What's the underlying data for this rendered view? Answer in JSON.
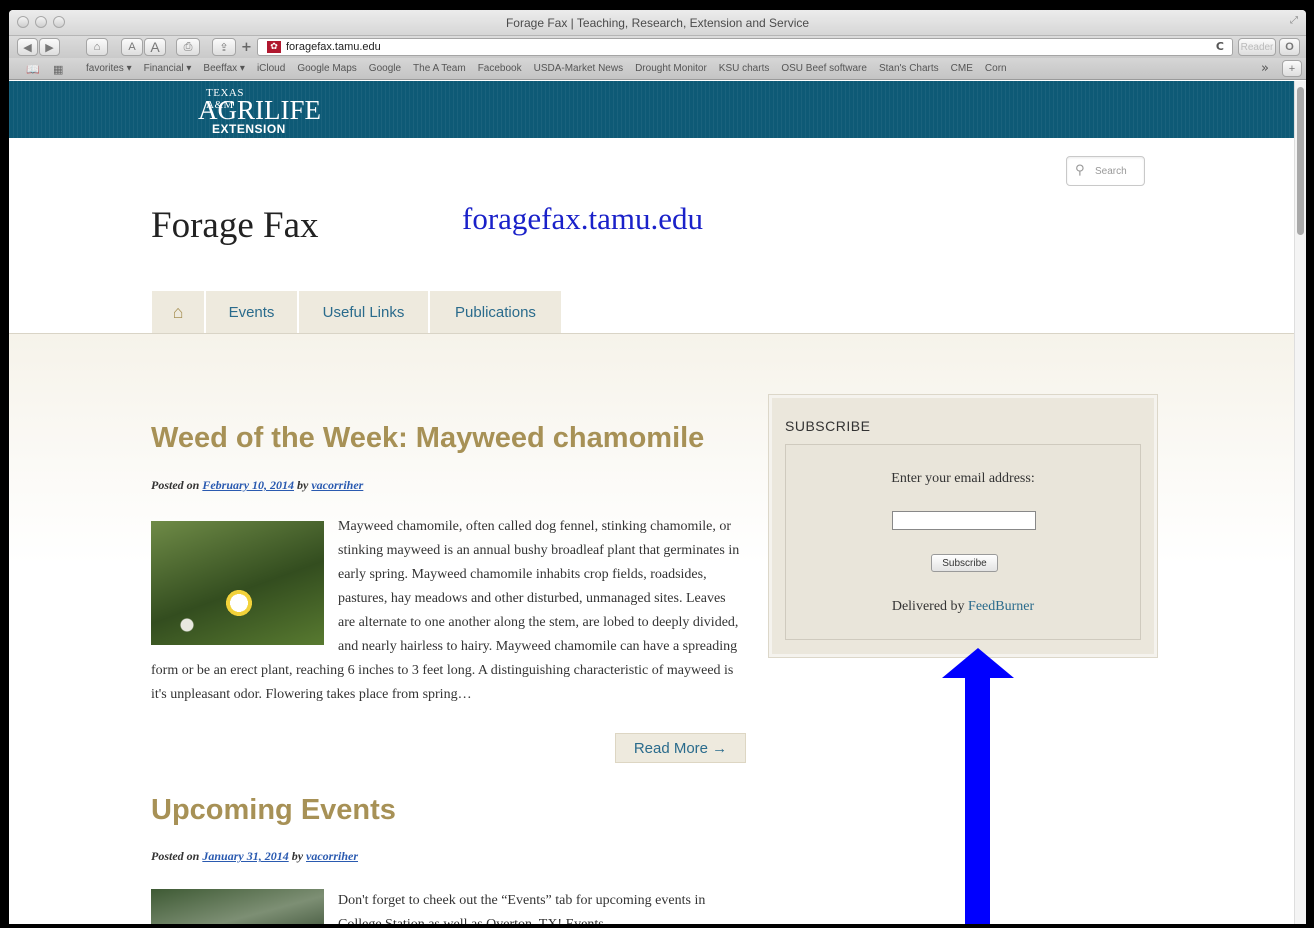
{
  "window": {
    "title": "Forage Fax | Teaching, Research, Extension and Service",
    "url": "foragefax.tamu.edu",
    "reader_label": "Reader"
  },
  "toolbar": {
    "back": "◀",
    "forward": "▶",
    "home": "⌂",
    "text_smaller": "A",
    "text_bigger": "A",
    "print": "⎙",
    "share": "⇪",
    "new_tab": "+",
    "reload": "C",
    "favicon": "✿",
    "downloads": "O"
  },
  "bookmarks": {
    "items": [
      "favorites ▾",
      "Financial ▾",
      "Beeffax ▾",
      "iCloud",
      "Google Maps",
      "Google",
      "The A Team",
      "Facebook",
      "USDA-Market News",
      "Drought Monitor",
      "KSU charts",
      "OSU Beef software",
      "Stan's Charts",
      "CME",
      "Corn"
    ],
    "overflow": "»",
    "add": "+"
  },
  "logo": {
    "line1": "TEXAS A&M",
    "line2": "AGRILIFE",
    "line3": "EXTENSION"
  },
  "search": {
    "placeholder": "Search"
  },
  "site": {
    "title": "Forage Fax",
    "url_annotation": "foragefax.tamu.edu"
  },
  "nav": {
    "home_icon": "⌂",
    "tabs": [
      "Events",
      "Useful Links",
      "Publications"
    ]
  },
  "posts": [
    {
      "title": "Weed of the Week: Mayweed chamomile",
      "posted_on": "Posted on",
      "date": "February 10, 2014",
      "by": "by",
      "author": "vacorriher",
      "excerpt": "Mayweed chamomile, often called dog fennel, stinking chamomile, or stinking mayweed is an annual bushy broadleaf plant that germinates in early spring. Mayweed chamomile inhabits crop fields, roadsides, pastures, hay meadows and other disturbed, unmanaged sites. Leaves are alternate to one another along the stem, are lobed to deeply divided, and nearly hairless to hairy. Mayweed chamomile can have a spreading form or be an erect plant, reaching 6 inches to 3 feet long. A distinguishing characteristic of mayweed is it's unpleasant odor. Flowering takes place from spring…",
      "read_more": "Read More →"
    },
    {
      "title": "Upcoming Events",
      "posted_on": "Posted on",
      "date": "January 31, 2014",
      "by": "by",
      "author": "vacorriher",
      "excerpt": "Don't forget to cheek out the “Events” tab for upcoming events in College Station as well as Overton, TX! Events"
    }
  ],
  "subscribe": {
    "heading": "SUBSCRIBE",
    "prompt": "Enter your email address:",
    "email_value": "",
    "button": "Subscribe",
    "delivered_by": "Delivered by",
    "feedburner": "FeedBurner"
  },
  "colors": {
    "banner": "#0e5a76",
    "post_title": "#a79156",
    "nav_tab": "#eeeade",
    "link": "#2a6b8c",
    "annotation_arrow": "#0000ff",
    "annotation_text": "#1a21c9"
  }
}
